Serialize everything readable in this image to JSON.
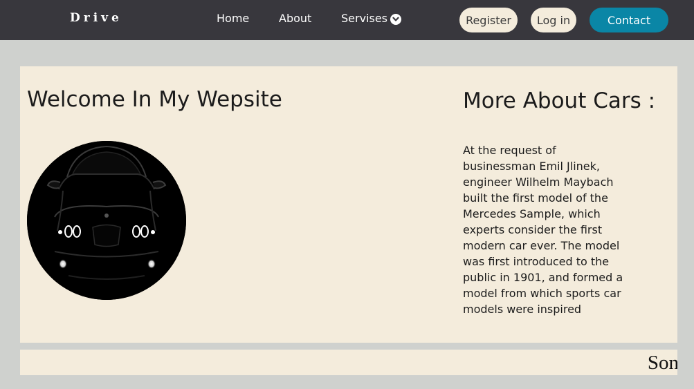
{
  "nav": {
    "brand": "Drive",
    "links": [
      "Home",
      "About",
      "Servises"
    ],
    "register_label": "Register",
    "login_label": "Log in",
    "contact_label": "Contact"
  },
  "hero": {
    "welcome_title": "Welcome In My Wepsite",
    "more_title": "More About Cars :",
    "more_text": "At the request of businessman Emil Jlinek, engineer Wilhelm Maybach built the first model of the Mercedes Sample, which experts consider the first modern car ever. The model was first introduced to the public in 1901, and formed a model from which sports car models were inspired"
  },
  "strip": {
    "text": "Son"
  },
  "colors": {
    "navbar": "#38373d",
    "page_bg": "#cfd1ce",
    "panel_bg": "#f4ecdc",
    "contact_accent": "#0a86a6"
  }
}
